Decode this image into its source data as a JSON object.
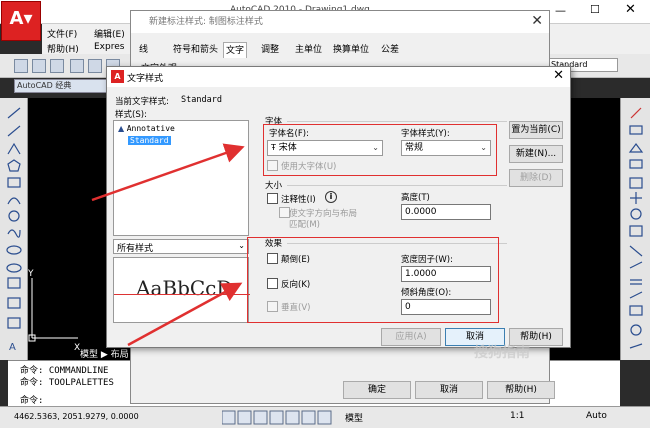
{
  "acad": {
    "window_title": "AutoCAD 2010 - Drawing1.dwg",
    "menus": [
      "文件(F)",
      "编辑(E)",
      "帮助(H)",
      "Expres"
    ],
    "workspace": "AutoCAD 经典",
    "model_tab": "模型",
    "layout_tab": "布局",
    "command_lines": [
      "命令:  COMMANDLINE",
      "命令:  TOOLPALETTES"
    ],
    "command_prompt": "命令:",
    "coords": "4462.5363,  2051.9279,  0.0000",
    "status_model": "模型",
    "annotation_scale": "1:1",
    "auto": "Auto",
    "layer_combo": "Standard",
    "watermark": "搜狗指南"
  },
  "bg_dialog": {
    "title": "新建标注样式: 制图标注样式",
    "tabs": [
      "线",
      "符号和箭头",
      "文字",
      "调整",
      "主单位",
      "换算单位",
      "公差"
    ],
    "text_appearance_label": "文字外观",
    "ok": "确定",
    "cancel": "取消",
    "help": "帮助(H)"
  },
  "dialog": {
    "title": "文字样式",
    "current_style_label": "当前文字样式:",
    "current_style": "Standard",
    "styles_label": "样式(S):",
    "styles": [
      "Annotative",
      "Standard"
    ],
    "filter": "所有样式",
    "preview": "AaBbCcD",
    "font_group": "字体",
    "font_name_label": "字体名(F):",
    "font_name": "宋体",
    "font_style_label": "字体样式(Y):",
    "font_style": "常规",
    "use_big_font": "使用大字体(U)",
    "size_group": "大小",
    "annotative": "注释性(I)",
    "match_layout": "使文字方向与布局",
    "match_layout2": "匹配(M)",
    "height_label": "高度(T)",
    "height": "0.0000",
    "effects_group": "效果",
    "upside_down": "颠倒(E)",
    "backwards": "反向(K)",
    "vertical": "垂直(V)",
    "width_factor_label": "宽度因子(W):",
    "width_factor": "1.0000",
    "oblique_label": "倾斜角度(O):",
    "oblique": "0",
    "set_current": "置为当前(C)",
    "new": "新建(N)...",
    "delete": "删除(D)",
    "apply": "应用(A)",
    "cancel": "取消",
    "help": "帮助(H)"
  },
  "colors": {
    "highlight": "#e03030",
    "selection": "#3399ff",
    "cad_red": "#d22222"
  }
}
